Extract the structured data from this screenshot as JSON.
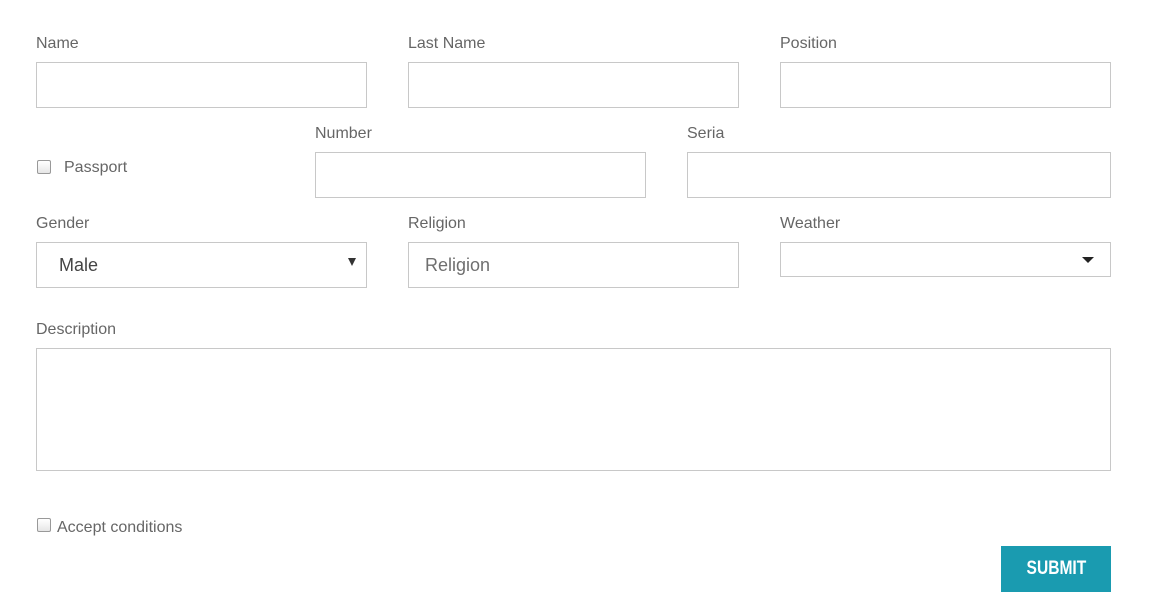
{
  "form": {
    "name_label": "Name",
    "last_name_label": "Last Name",
    "position_label": "Position",
    "passport_label": "Passport",
    "number_label": "Number",
    "seria_label": "Seria",
    "gender_label": "Gender",
    "gender_value": "Male",
    "religion_label": "Religion",
    "religion_placeholder": "Religion",
    "weather_label": "Weather",
    "weather_value": "",
    "description_label": "Description",
    "accept_label": "Accept conditions",
    "submit_label": "SUBMIT"
  },
  "colors": {
    "accent": "#1a9bb0",
    "border": "#c8c8c8"
  },
  "icons": {
    "gender_dropdown": "chevron-down-icon",
    "weather_dropdown": "caret-down-icon"
  }
}
